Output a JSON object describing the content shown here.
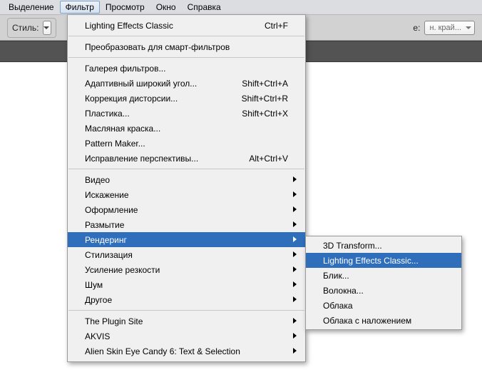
{
  "menubar": {
    "items": [
      "Выделение",
      "Фильтр",
      "Просмотр",
      "Окно",
      "Справка"
    ],
    "active_index": 1
  },
  "toolbar": {
    "style_label": "Стиль:",
    "right_label_prefix": "е:",
    "right_field": "н. край..."
  },
  "strip": {
    "label": ""
  },
  "menu": {
    "section1": [
      {
        "label": "Lighting Effects Classic",
        "shortcut": "Ctrl+F"
      }
    ],
    "section2": [
      {
        "label": "Преобразовать для смарт-фильтров"
      }
    ],
    "section3": [
      {
        "label": "Галерея фильтров..."
      },
      {
        "label": "Адаптивный широкий угол...",
        "shortcut": "Shift+Ctrl+A"
      },
      {
        "label": "Коррекция дисторсии...",
        "shortcut": "Shift+Ctrl+R"
      },
      {
        "label": "Пластика...",
        "shortcut": "Shift+Ctrl+X"
      },
      {
        "label": "Масляная краска..."
      },
      {
        "label": "Pattern Maker..."
      },
      {
        "label": "Исправление перспективы...",
        "shortcut": "Alt+Ctrl+V"
      }
    ],
    "section4": [
      {
        "label": "Видео",
        "sub": true
      },
      {
        "label": "Искажение",
        "sub": true
      },
      {
        "label": "Оформление",
        "sub": true
      },
      {
        "label": "Размытие",
        "sub": true
      },
      {
        "label": "Рендеринг",
        "sub": true,
        "hl": true
      },
      {
        "label": "Стилизация",
        "sub": true
      },
      {
        "label": "Усиление резкости",
        "sub": true
      },
      {
        "label": "Шум",
        "sub": true
      },
      {
        "label": "Другое",
        "sub": true
      }
    ],
    "section5": [
      {
        "label": "The Plugin Site",
        "sub": true
      },
      {
        "label": "AKVIS",
        "sub": true
      },
      {
        "label": "Alien Skin Eye Candy 6: Text & Selection",
        "sub": true
      }
    ]
  },
  "submenu": {
    "items": [
      {
        "label": "3D Transform..."
      },
      {
        "label": "Lighting Effects Classic...",
        "hl": true
      },
      {
        "label": "Блик..."
      },
      {
        "label": "Волокна..."
      },
      {
        "label": "Облака"
      },
      {
        "label": "Облака с наложением"
      }
    ]
  }
}
